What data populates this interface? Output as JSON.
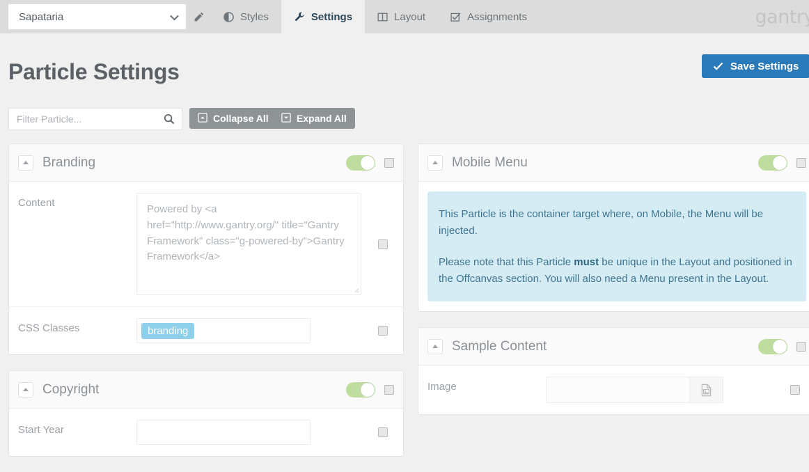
{
  "topbar": {
    "theme_select": {
      "value": "Sapataria",
      "icon": "chevron-down-icon"
    },
    "edit_icon": "pencil-icon",
    "tabs": [
      {
        "id": "styles",
        "label": "Styles",
        "icon": "contrast-icon",
        "active": false
      },
      {
        "id": "settings",
        "label": "Settings",
        "icon": "wrench-icon",
        "active": true
      },
      {
        "id": "layout",
        "label": "Layout",
        "icon": "columns-icon",
        "active": false
      },
      {
        "id": "assignments",
        "label": "Assignments",
        "icon": "checkbox-icon",
        "active": false
      }
    ],
    "logo": "gantry"
  },
  "header": {
    "title": "Particle Settings",
    "save_label": "Save Settings",
    "save_icon": "check-icon",
    "save_color": "#2a7ab9"
  },
  "toolbar": {
    "filter_placeholder": "Filter Particle...",
    "filter_value": "",
    "search_icon": "search-icon",
    "collapse_label": "Collapse All",
    "collapse_icon": "collapse-square-icon",
    "expand_label": "Expand All",
    "expand_icon": "expand-square-icon"
  },
  "panels": {
    "branding": {
      "title": "Branding",
      "enabled": true,
      "collapse_icon": "caret-up-icon",
      "fields": [
        {
          "label": "Content",
          "type": "textarea",
          "value": "Powered by <a href=\"http://www.gantry.org/\" title=\"Gantry Framework\" class=\"g-powered-by\">Gantry Framework</a>"
        },
        {
          "label": "CSS Classes",
          "type": "tags",
          "tags": [
            "branding"
          ]
        }
      ]
    },
    "copyright": {
      "title": "Copyright",
      "enabled": true,
      "collapse_icon": "caret-up-icon",
      "fields": [
        {
          "label": "Start Year",
          "type": "text",
          "value": ""
        }
      ]
    },
    "mobile_menu": {
      "title": "Mobile Menu",
      "enabled": true,
      "collapse_icon": "caret-up-icon",
      "notice": {
        "paragraph1": "This Particle is the container target where, on Mobile, the Menu will be injected.",
        "paragraph2_a": "Please note that this Particle ",
        "paragraph2_strong": "must",
        "paragraph2_b": " be unique in the Layout and positioned in the Offcanvas section. You will also need a Menu present in the Layout.",
        "bg_color": "#d6ecf5",
        "text_color": "#3c7490"
      }
    },
    "sample_content": {
      "title": "Sample Content",
      "enabled": true,
      "collapse_icon": "caret-up-icon",
      "fields": [
        {
          "label": "Image",
          "type": "image",
          "value": "",
          "picker_icon": "image-file-icon"
        }
      ]
    }
  },
  "colors": {
    "toggle_on": "#bedd9e",
    "tag": "#8ed0ea",
    "topbar": "#dcdcdc",
    "page_bg": "#f0f0f0"
  }
}
